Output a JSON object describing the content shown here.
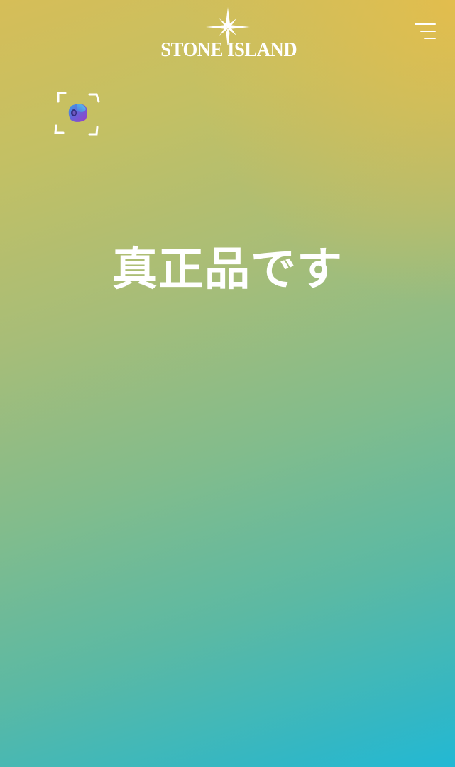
{
  "header": {
    "logo_text": "STONE ISLAND",
    "logo_icon": "compass-rose-icon",
    "menu_icon": "hamburger-menu-icon"
  },
  "scan": {
    "icon": "scan-frame-icon"
  },
  "main": {
    "status_text": "真正品です"
  },
  "colors": {
    "gradient_top": "#d6be58",
    "gradient_top_right": "#ecbc46",
    "gradient_middle": "#82bc8c",
    "gradient_bottom": "#22b8d4",
    "text": "#ffffff"
  }
}
